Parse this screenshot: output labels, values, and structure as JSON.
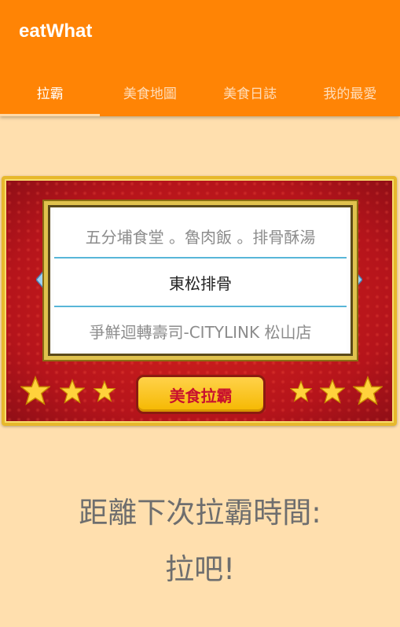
{
  "app": {
    "title": "eatWhat"
  },
  "tabs": [
    {
      "label": "拉霸",
      "active": true
    },
    {
      "label": "美食地圖",
      "active": false
    },
    {
      "label": "美食日誌",
      "active": false
    },
    {
      "label": "我的最愛",
      "active": false
    }
  ],
  "slot": {
    "items": [
      "五分埔食堂 。魯肉飯 。排骨酥湯",
      "東松排骨",
      "爭鮮迴轉壽司-CITYLINK 松山店"
    ],
    "button_label": "美食拉霸"
  },
  "status": {
    "next_time_label": "距離下次拉霸時間:",
    "go_label": "拉吧!"
  },
  "colors": {
    "app_bar": "#FF8405",
    "background": "#FFDFAE",
    "machine_red": "#C8191D",
    "gold": "#F5B800",
    "divider": "#58B6D8"
  }
}
